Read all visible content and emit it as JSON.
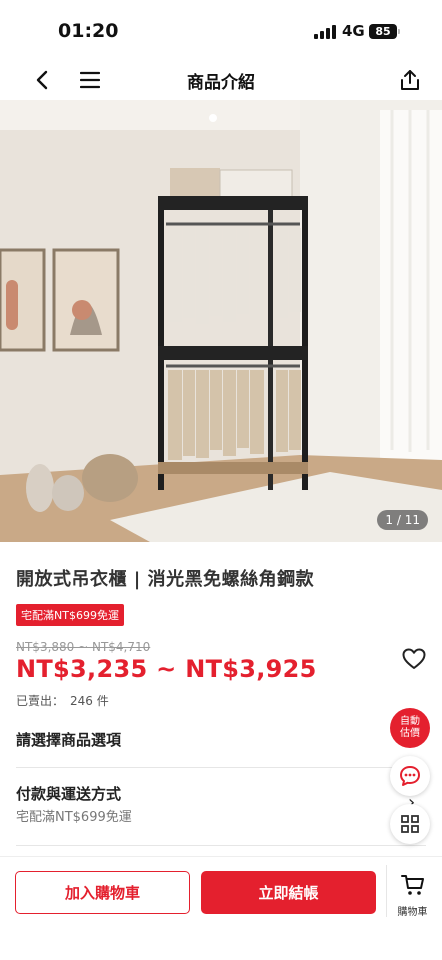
{
  "status": {
    "time": "01:20",
    "network": "4G",
    "battery": "85"
  },
  "nav": {
    "title": "商品介紹"
  },
  "gallery": {
    "counter": "1 / 11"
  },
  "product": {
    "title": "開放式吊衣櫃 | 消光黑免螺絲角鋼款",
    "shipping_badge": "宅配滿NT$699免運",
    "original_price": "NT$3,880 ~ NT$4,710",
    "price": "NT$3,235 ~ NT$3,925",
    "sold_label": "已賣出：",
    "sold_count": "246 件"
  },
  "sections": {
    "select_option": "請選擇商品選項",
    "payment_title": "付款與運送方式",
    "payment_sub": "宅配滿NT$699免運"
  },
  "fab": {
    "auto_quote": "自動\n估價"
  },
  "bottom": {
    "add_to_cart": "加入購物車",
    "buy_now": "立即結帳",
    "cart_label": "購物車"
  },
  "colors": {
    "brand_red": "#e4202e"
  },
  "icons": [
    "back-icon",
    "menu-icon",
    "share-icon",
    "heart-icon",
    "chat-icon",
    "grid-icon",
    "cart-icon",
    "chevron-right-icon"
  ]
}
